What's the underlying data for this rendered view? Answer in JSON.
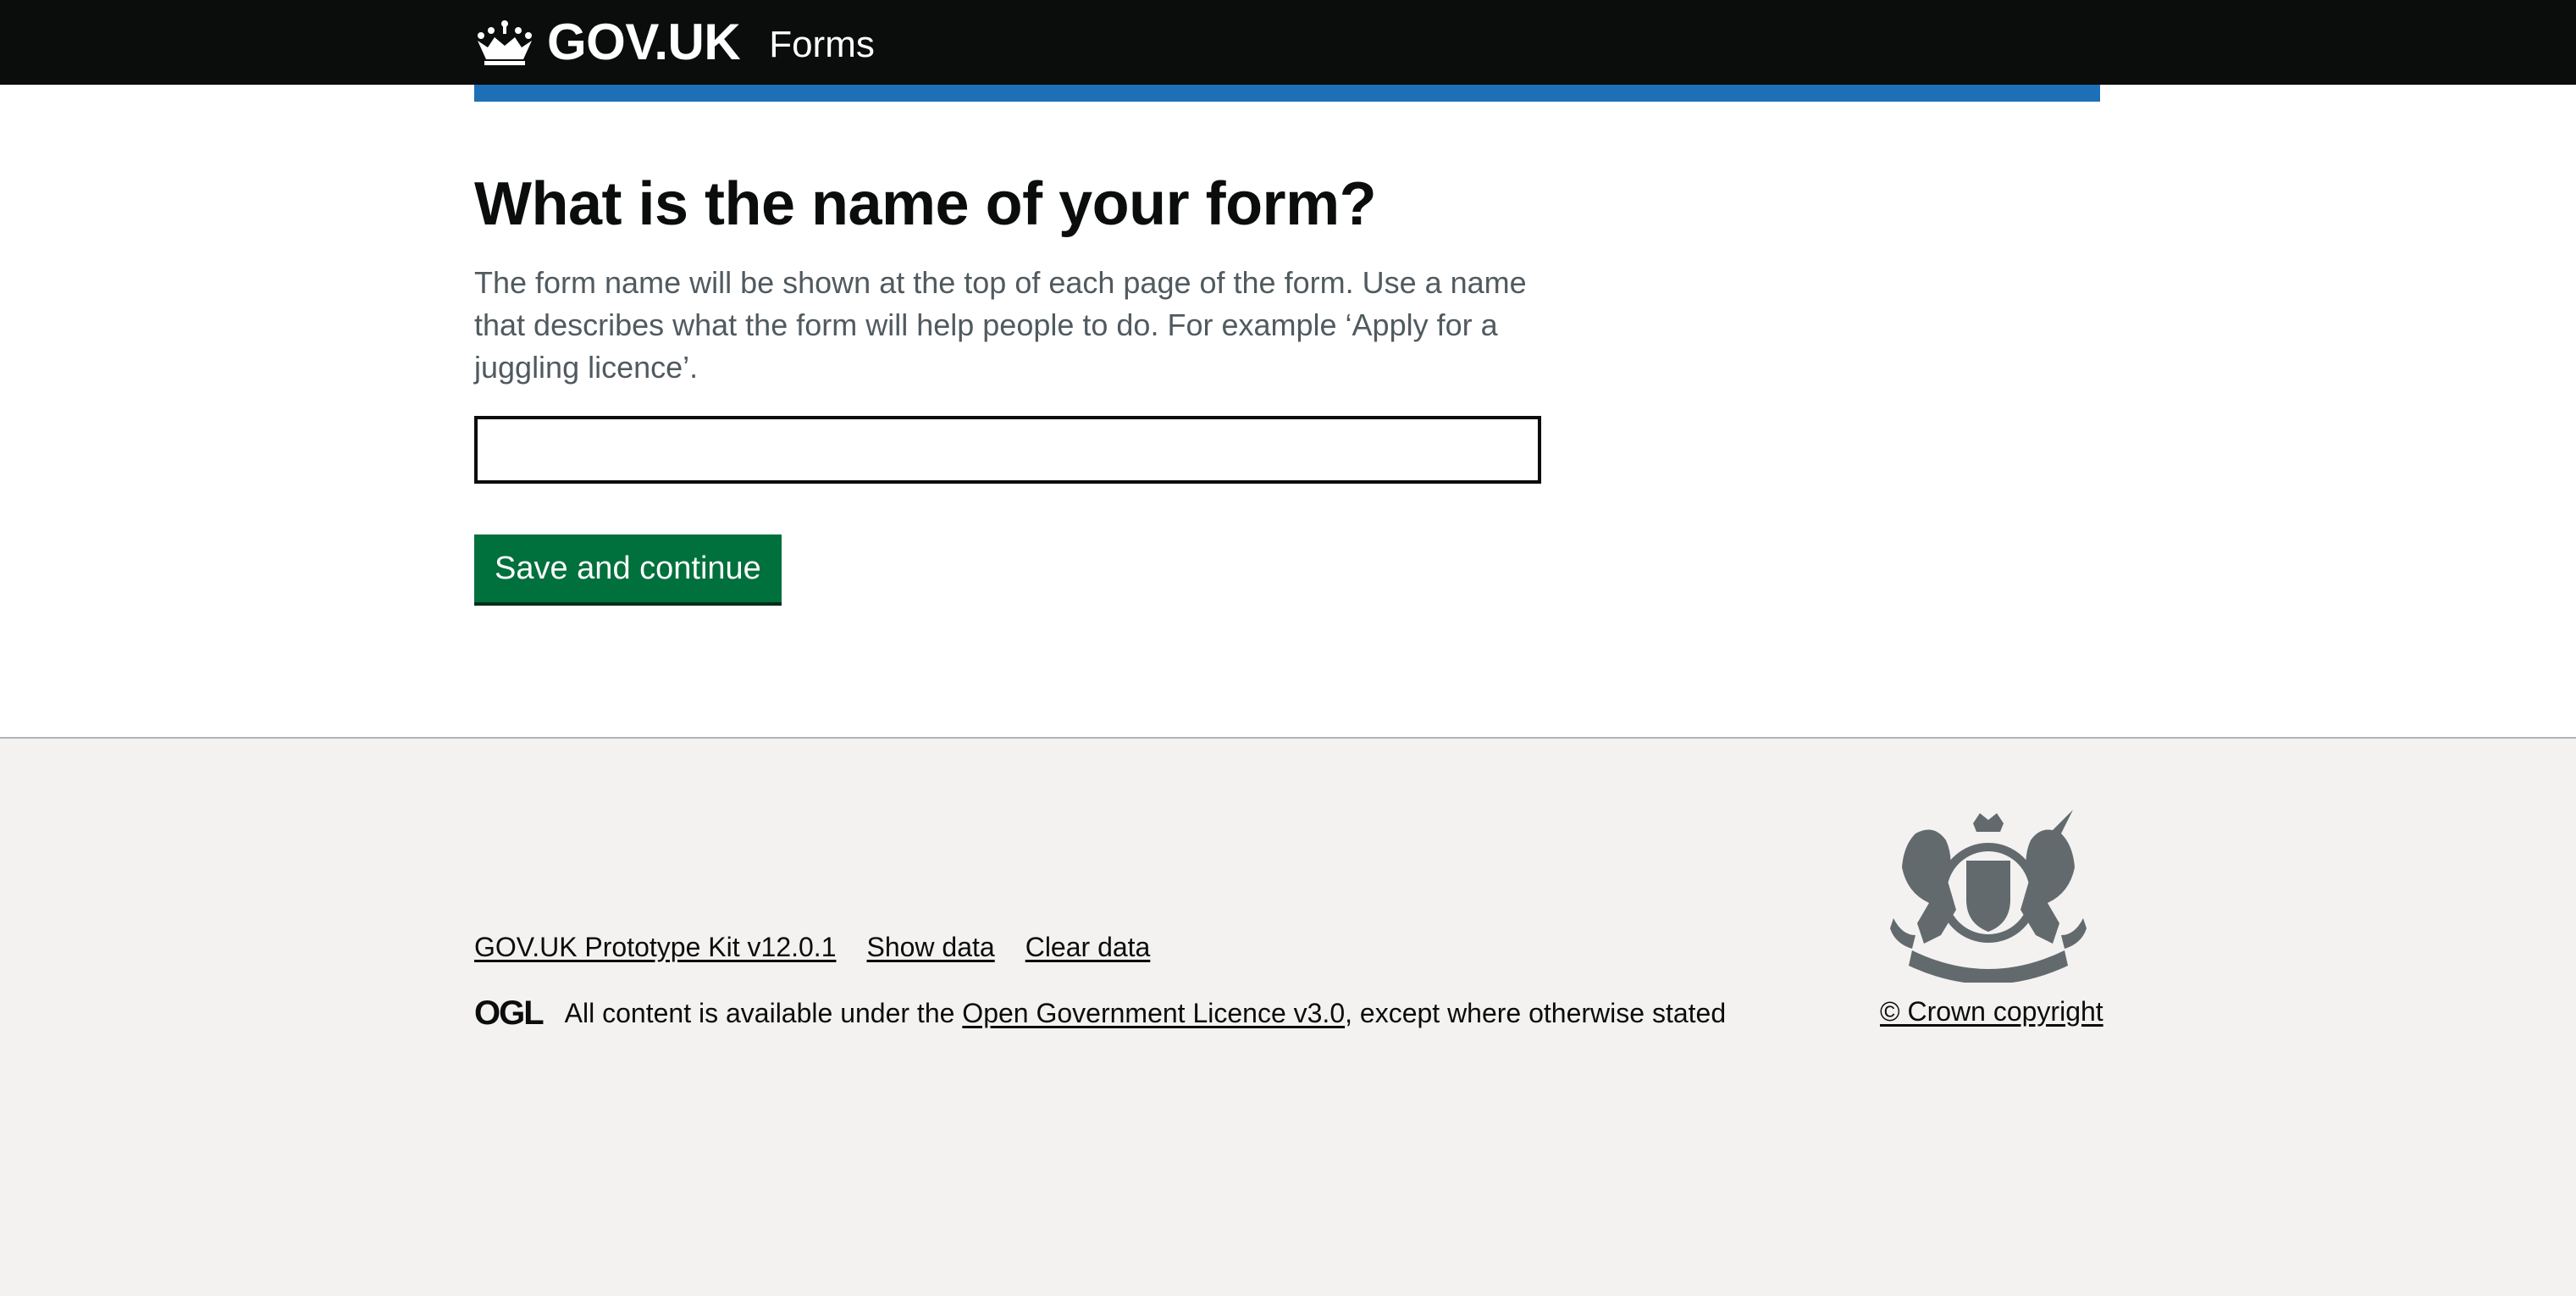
{
  "header": {
    "brand": "GOV.UK",
    "service_name": "Forms",
    "logo_icon": "crown-icon"
  },
  "main": {
    "title": "What is the name of your form?",
    "hint": "The form name will be shown at the top of each page of the form. Use a name that describes what the form will help people to do. For example ‘Apply for a juggling licence’.",
    "input_value": "",
    "button_label": "Save and continue"
  },
  "footer": {
    "links": [
      "GOV.UK Prototype Kit v12.0.1",
      "Show data",
      "Clear data"
    ],
    "ogl_logo": "OGL",
    "licence_prefix": "All content is available under the ",
    "licence_link": "Open Government Licence v3.0",
    "licence_suffix": ", except where otherwise stated",
    "crest_icon": "royal-coat-of-arms-icon",
    "crown_copyright": "© Crown copyright"
  },
  "colors": {
    "header_bg": "#0b0c0c",
    "accent_blue": "#1d70b8",
    "button_green": "#00703c",
    "footer_bg": "#f3f2f1",
    "hint_text": "#505a5f"
  }
}
